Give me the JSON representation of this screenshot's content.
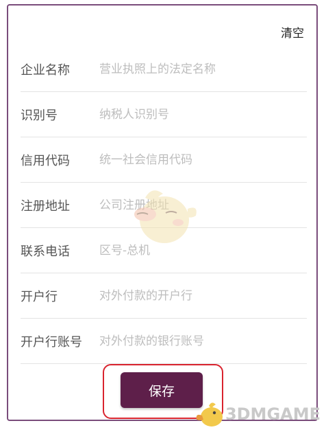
{
  "header": {
    "clear_label": "清空"
  },
  "form": {
    "fields": [
      {
        "label": "企业名称",
        "placeholder": "营业执照上的法定名称",
        "value": ""
      },
      {
        "label": "识别号",
        "placeholder": "纳税人识别号",
        "value": ""
      },
      {
        "label": "信用代码",
        "placeholder": "统一社会信用代码",
        "value": ""
      },
      {
        "label": "注册地址",
        "placeholder": "公司注册地址",
        "value": ""
      },
      {
        "label": "联系电话",
        "placeholder": "区号-总机",
        "value": ""
      },
      {
        "label": "开户行",
        "placeholder": "对外付款的开户行",
        "value": ""
      },
      {
        "label": "开户行账号",
        "placeholder": "对外付款的银行账号",
        "value": ""
      }
    ]
  },
  "footer": {
    "save_label": "保存"
  },
  "watermark": {
    "text": "3DMGAME"
  },
  "colors": {
    "frame": "#7a4c7b",
    "save_button": "#5e1f4a",
    "highlight": "#d9232e",
    "placeholder": "#bdbdbd"
  }
}
